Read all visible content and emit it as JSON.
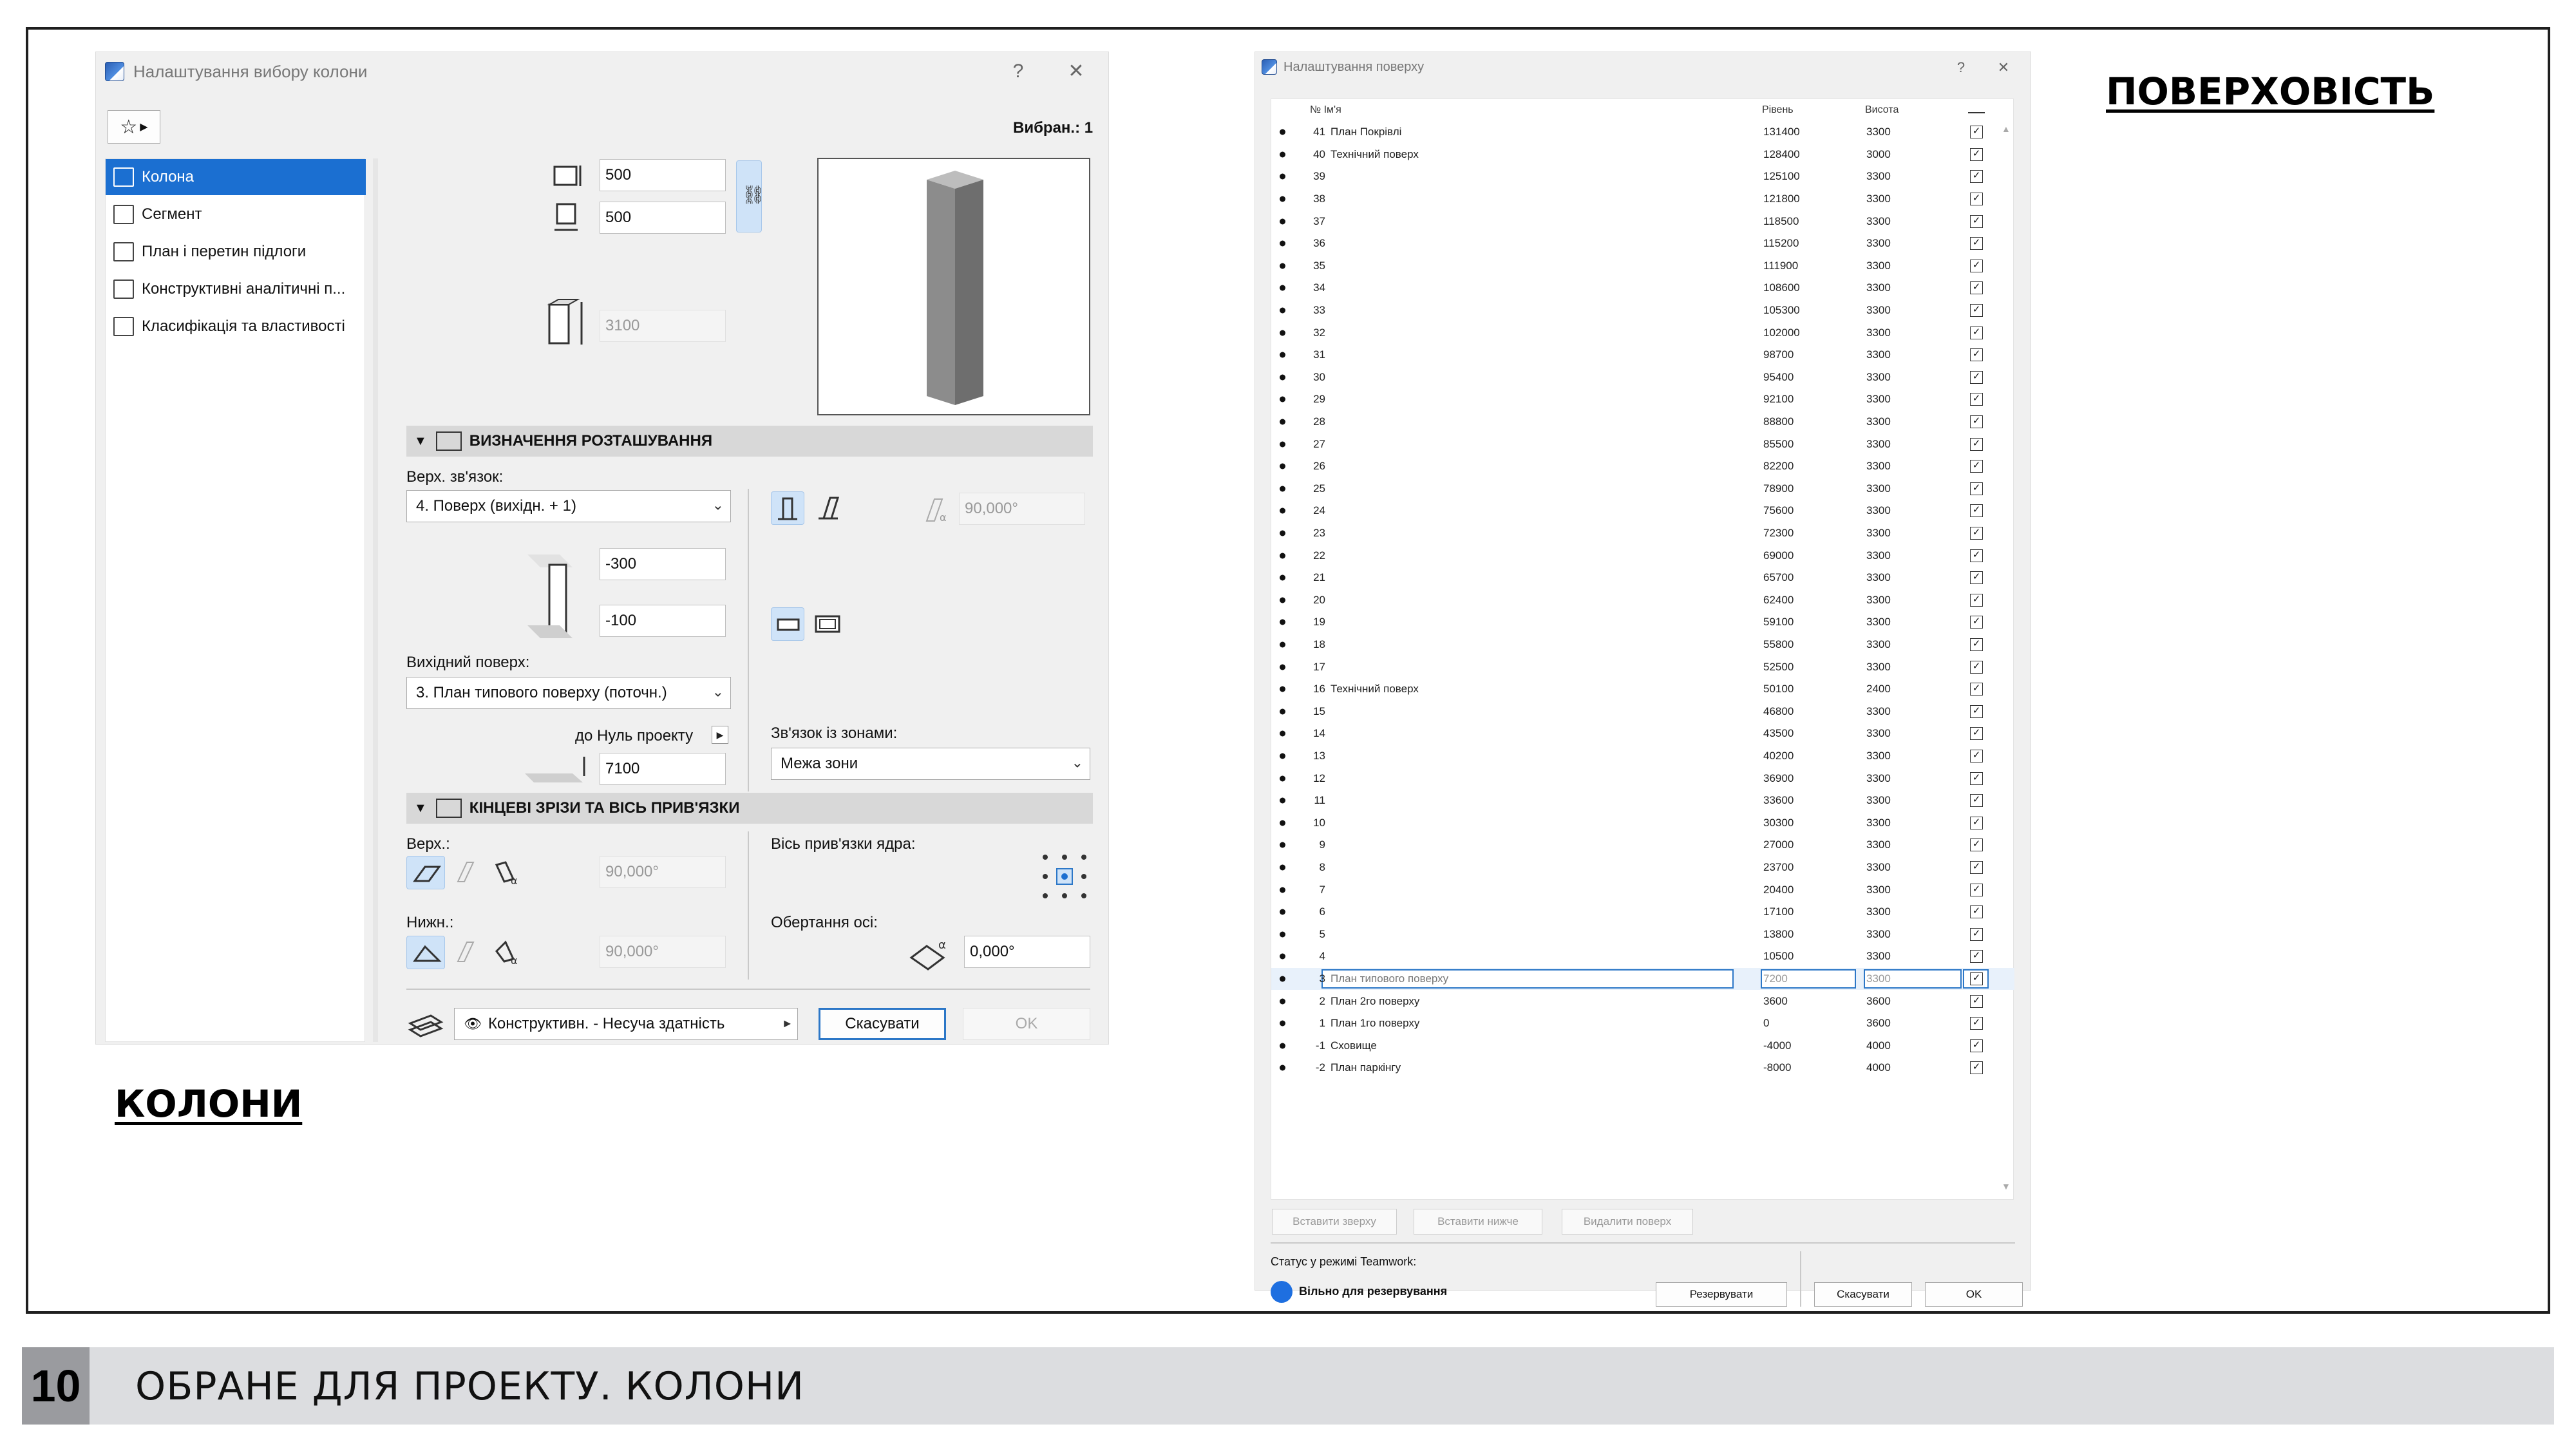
{
  "slide": {
    "page_number": "10",
    "footer_title": "ОБРАНЕ ДЛЯ ПРОЕКТУ. КОЛОНИ",
    "caption_left": "КОЛОНИ",
    "caption_right": "ПОВЕРХОВІСТЬ"
  },
  "column_dialog": {
    "title": "Налаштування вибору колони",
    "help_label": "?",
    "close_label": "✕",
    "selected_count": "Вибран.: 1",
    "sidebar": [
      {
        "label": "Колона",
        "icon": "column-icon",
        "selected": true
      },
      {
        "label": "Сегмент",
        "icon": "segment-icon",
        "selected": false
      },
      {
        "label": "План і перетин підлоги",
        "icon": "floor-plan-icon",
        "selected": false
      },
      {
        "label": "Конструктивні аналітичні п...",
        "icon": "structural-analytic-icon",
        "selected": false
      },
      {
        "label": "Класифікація та властивості",
        "icon": "classification-icon",
        "selected": false
      }
    ],
    "size": {
      "width": "500",
      "depth": "500",
      "height": "3100"
    },
    "positioning": {
      "section_title": "ВИЗНАЧЕННЯ РОЗТАШУВАННЯ",
      "top_link_label": "Верх. зв'язок:",
      "top_link_value": "4. Поверх (вихідн. + 1)",
      "top_offset": "-300",
      "bottom_offset": "-100",
      "home_story_label": "Вихідний поверх:",
      "home_story_value": "3. План типового поверху (поточн.)",
      "to_project_zero_label": "до Нуль проекту",
      "to_project_zero_value": "7100",
      "tilt_angle": "90,000°",
      "zone_relation_label": "Зв'язок із зонами:",
      "zone_relation_value": "Межа зони"
    },
    "end_cuts": {
      "section_title": "КІНЦЕВІ ЗРІЗИ ТА ВІСЬ ПРИВ'ЯЗКИ",
      "top_label": "Верх.:",
      "top_angle": "90,000°",
      "bottom_label": "Нижн.:",
      "bottom_angle": "90,000°",
      "anchor_label": "Вісь прив'язки ядра:",
      "rotation_label": "Обертання осі:",
      "rotation_value": "0,000°"
    },
    "footer": {
      "layer_value": "Конструктивн. - Несуча здатність",
      "cancel_label": "Скасувати",
      "ok_label": "OK"
    }
  },
  "story_dialog": {
    "title": "Налаштування поверху",
    "help_label": "?",
    "close_label": "✕",
    "columns": {
      "num_name": "№ Ім'я",
      "level": "Рівень",
      "height": "Висота"
    },
    "rows": [
      {
        "num": "41",
        "name": "План Покрівлі",
        "level": "131400",
        "height": "3300"
      },
      {
        "num": "40",
        "name": "Технічний поверх",
        "level": "128400",
        "height": "3000"
      },
      {
        "num": "39",
        "name": "",
        "level": "125100",
        "height": "3300"
      },
      {
        "num": "38",
        "name": "",
        "level": "121800",
        "height": "3300"
      },
      {
        "num": "37",
        "name": "",
        "level": "118500",
        "height": "3300"
      },
      {
        "num": "36",
        "name": "",
        "level": "115200",
        "height": "3300"
      },
      {
        "num": "35",
        "name": "",
        "level": "111900",
        "height": "3300"
      },
      {
        "num": "34",
        "name": "",
        "level": "108600",
        "height": "3300"
      },
      {
        "num": "33",
        "name": "",
        "level": "105300",
        "height": "3300"
      },
      {
        "num": "32",
        "name": "",
        "level": "102000",
        "height": "3300"
      },
      {
        "num": "31",
        "name": "",
        "level": "98700",
        "height": "3300"
      },
      {
        "num": "30",
        "name": "",
        "level": "95400",
        "height": "3300"
      },
      {
        "num": "29",
        "name": "",
        "level": "92100",
        "height": "3300"
      },
      {
        "num": "28",
        "name": "",
        "level": "88800",
        "height": "3300"
      },
      {
        "num": "27",
        "name": "",
        "level": "85500",
        "height": "3300"
      },
      {
        "num": "26",
        "name": "",
        "level": "82200",
        "height": "3300"
      },
      {
        "num": "25",
        "name": "",
        "level": "78900",
        "height": "3300"
      },
      {
        "num": "24",
        "name": "",
        "level": "75600",
        "height": "3300"
      },
      {
        "num": "23",
        "name": "",
        "level": "72300",
        "height": "3300"
      },
      {
        "num": "22",
        "name": "",
        "level": "69000",
        "height": "3300"
      },
      {
        "num": "21",
        "name": "",
        "level": "65700",
        "height": "3300"
      },
      {
        "num": "20",
        "name": "",
        "level": "62400",
        "height": "3300"
      },
      {
        "num": "19",
        "name": "",
        "level": "59100",
        "height": "3300"
      },
      {
        "num": "18",
        "name": "",
        "level": "55800",
        "height": "3300"
      },
      {
        "num": "17",
        "name": "",
        "level": "52500",
        "height": "3300"
      },
      {
        "num": "16",
        "name": "Технічний поверх",
        "level": "50100",
        "height": "2400"
      },
      {
        "num": "15",
        "name": "",
        "level": "46800",
        "height": "3300"
      },
      {
        "num": "14",
        "name": "",
        "level": "43500",
        "height": "3300"
      },
      {
        "num": "13",
        "name": "",
        "level": "40200",
        "height": "3300"
      },
      {
        "num": "12",
        "name": "",
        "level": "36900",
        "height": "3300"
      },
      {
        "num": "11",
        "name": "",
        "level": "33600",
        "height": "3300"
      },
      {
        "num": "10",
        "name": "",
        "level": "30300",
        "height": "3300"
      },
      {
        "num": "9",
        "name": "",
        "level": "27000",
        "height": "3300"
      },
      {
        "num": "8",
        "name": "",
        "level": "23700",
        "height": "3300"
      },
      {
        "num": "7",
        "name": "",
        "level": "20400",
        "height": "3300"
      },
      {
        "num": "6",
        "name": "",
        "level": "17100",
        "height": "3300"
      },
      {
        "num": "5",
        "name": "",
        "level": "13800",
        "height": "3300"
      },
      {
        "num": "4",
        "name": "",
        "level": "10500",
        "height": "3300"
      },
      {
        "num": "3",
        "name": "План типового поверху",
        "level": "7200",
        "height": "3300",
        "selected": true
      },
      {
        "num": "2",
        "name": "План 2го поверху",
        "level": "3600",
        "height": "3600"
      },
      {
        "num": "1",
        "name": "План 1го поверху",
        "level": "0",
        "height": "3600"
      },
      {
        "num": "-1",
        "name": "Сховище",
        "level": "-4000",
        "height": "4000"
      },
      {
        "num": "-2",
        "name": "План паркінгу",
        "level": "-8000",
        "height": "4000"
      }
    ],
    "buttons": {
      "insert_above": "Вставити зверху",
      "insert_below": "Вставити нижче",
      "delete_story": "Видалити поверх"
    },
    "teamwork": {
      "status_label": "Статус у режимі Teamwork:",
      "status_value": "Вільно для резервування",
      "status_color": "#1e6fe0",
      "reserve_label": "Резервувати",
      "cancel_label": "Скасувати",
      "ok_label": "OK"
    }
  }
}
